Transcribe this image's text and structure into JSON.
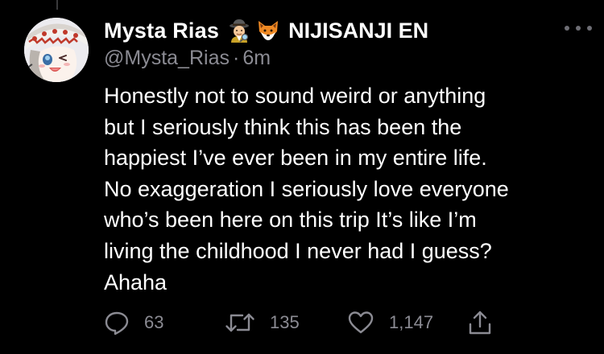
{
  "tweet": {
    "author": {
      "display_name": "Mysta Rias",
      "badges": [
        "detective-emoji",
        "fox-emoji"
      ],
      "org_name": "NIJISANJI EN",
      "handle": "@Mysta_Rias",
      "separator": "·",
      "timestamp": "6m"
    },
    "text": "Honestly not to sound weird or anything\nbut I seriously think this has been the\nhappiest I’ve ever been in my entire life.\nNo exaggeration I seriously love everyone\nwho’s been here on this trip It’s like I’m\nliving the childhood I never had I guess?\nAhaha",
    "actions": {
      "reply": {
        "icon": "reply-icon",
        "count": "63"
      },
      "retweet": {
        "icon": "retweet-icon",
        "count": "135"
      },
      "like": {
        "icon": "heart-icon",
        "count": "1,147"
      },
      "share": {
        "icon": "share-icon"
      }
    },
    "more_icon": "more-dots-icon"
  },
  "colors": {
    "background": "#000000",
    "text_primary": "#ffffff",
    "text_secondary": "#8b8b93",
    "icon_gray": "#8b8b93"
  }
}
